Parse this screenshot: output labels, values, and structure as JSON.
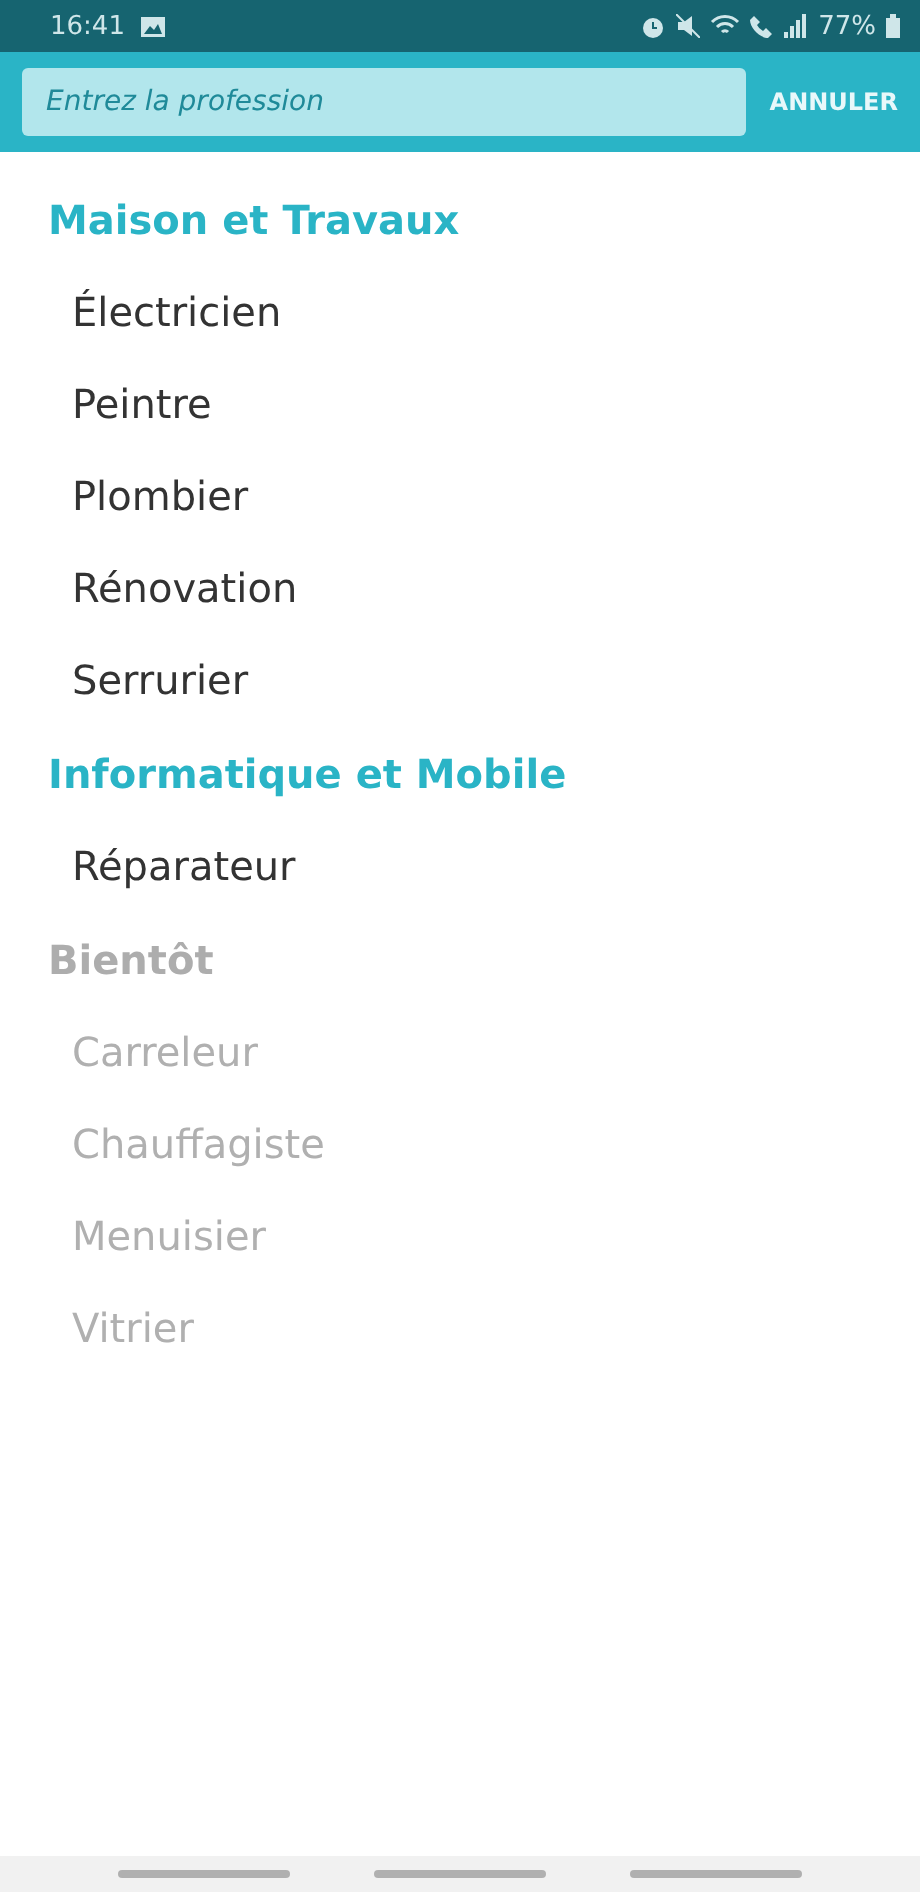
{
  "status_bar": {
    "time": "16:41",
    "battery": "77%"
  },
  "search": {
    "placeholder": "Entrez la profession",
    "cancel": "ANNULER"
  },
  "sections": [
    {
      "title": "Maison et Travaux",
      "disabled": false,
      "items": [
        "Électricien",
        "Peintre",
        "Plombier",
        "Rénovation",
        "Serrurier"
      ]
    },
    {
      "title": "Informatique et Mobile",
      "disabled": false,
      "items": [
        "Réparateur"
      ]
    },
    {
      "title": "Bientôt",
      "disabled": true,
      "items": [
        "Carreleur",
        "Chauffagiste",
        "Menuisier",
        "Vitrier"
      ]
    }
  ]
}
